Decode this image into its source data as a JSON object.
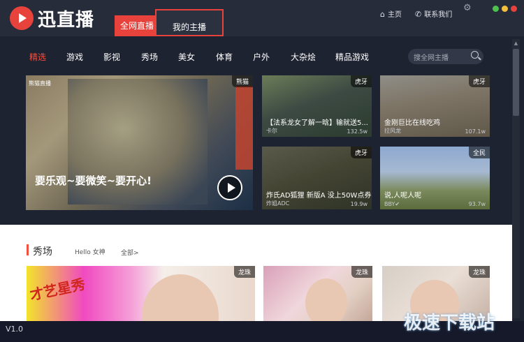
{
  "app": {
    "name": "迅直播"
  },
  "header_tabs": [
    {
      "label": "全网直播"
    },
    {
      "label": "我的主播"
    }
  ],
  "top_links": {
    "home": "主页",
    "contact": "联系我们"
  },
  "window_colors": {
    "green": "#4cc24c",
    "yellow": "#f2c03b",
    "red": "#e8423c"
  },
  "nav": {
    "items": [
      {
        "label": "精选"
      },
      {
        "label": "游戏"
      },
      {
        "label": "影视"
      },
      {
        "label": "秀场"
      },
      {
        "label": "美女"
      },
      {
        "label": "体育"
      },
      {
        "label": "户外"
      },
      {
        "label": "大杂烩"
      },
      {
        "label": "精品游戏"
      }
    ],
    "search_placeholder": "搜全网主播"
  },
  "featured": {
    "brand": "熊猫直播",
    "badge": "熊猫",
    "title": "要乐观~要微笑~要开心!"
  },
  "thumbs": [
    {
      "badge": "虎牙",
      "title": "【法系龙女了解一晗】输就送5...",
      "streamer": "卡尔",
      "views": "132.5w"
    },
    {
      "badge": "虎牙",
      "title": "金刚巨比在线吃鸡",
      "streamer": "拉风龙",
      "views": "107.1w"
    },
    {
      "badge": "虎牙",
      "title": "炸氏AD狐狸 新版A 没上50W点券",
      "streamer": "炸姐ADC",
      "views": "19.9w"
    },
    {
      "badge": "全民",
      "title": "说,人呢人呢",
      "streamer": "BBY✔",
      "views": "93.7w"
    }
  ],
  "section": {
    "title": "秀场",
    "subtitle": "Hello 女神",
    "all_link": "全部>",
    "cards": [
      {
        "badge": "龙珠",
        "overlay": "才艺星秀"
      },
      {
        "badge": "龙珠"
      },
      {
        "badge": "龙珠"
      }
    ]
  },
  "status": {
    "version": "V1.0"
  },
  "watermark": "极速下载站",
  "accent_color": "#e8423c"
}
